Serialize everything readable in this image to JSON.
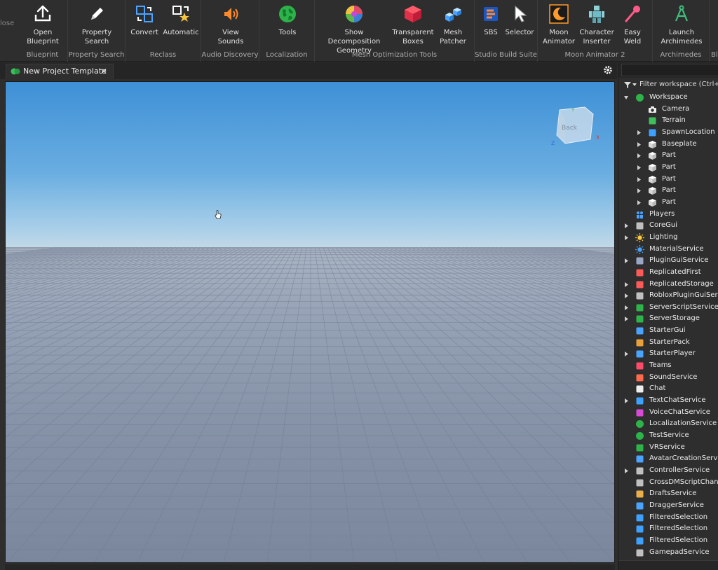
{
  "ribbon": {
    "partial_left_label": "lose",
    "groups": [
      {
        "label": "Blueprint",
        "tools": [
          {
            "label": "Open\nBlueprint",
            "icon": "upload-icon"
          }
        ]
      },
      {
        "label": "Property Search",
        "tools": [
          {
            "label": "Property\nSearch",
            "icon": "pencil-icon"
          }
        ]
      },
      {
        "label": "Reclass",
        "tools": [
          {
            "label": "Convert",
            "icon": "convert-icon"
          },
          {
            "label": "Automatic",
            "icon": "automatic-icon"
          }
        ]
      },
      {
        "label": "Audio Discovery",
        "tools": [
          {
            "label": "View\nSounds",
            "icon": "speaker-icon"
          }
        ]
      },
      {
        "label": "Localization",
        "tools": [
          {
            "label": "Tools",
            "icon": "globe-icon"
          }
        ]
      },
      {
        "label": "Mesh Optimization Tools",
        "tools": [
          {
            "label": "Show Decomposition\nGeometry",
            "icon": "decomposition-icon"
          },
          {
            "label": "Transparent\nBoxes",
            "icon": "red-cube-icon"
          },
          {
            "label": "Mesh\nPatcher",
            "icon": "blue-blocks-icon"
          }
        ]
      },
      {
        "label": "Studio Build Suite",
        "tools": [
          {
            "label": "SBS",
            "icon": "sbs-icon"
          },
          {
            "label": "Selector",
            "icon": "pointer-icon"
          }
        ]
      },
      {
        "label": "Moon Animator 2",
        "tools": [
          {
            "label": "Moon\nAnimator",
            "icon": "moon-icon"
          },
          {
            "label": "Character\nInserter",
            "icon": "character-icon"
          },
          {
            "label": "Easy\nWeld",
            "icon": "weld-icon"
          }
        ]
      },
      {
        "label": "Archimedes",
        "tools": [
          {
            "label": "Launch\nArchimedes",
            "icon": "compass-icon"
          }
        ]
      }
    ],
    "partial_right_label": "Bl"
  },
  "tabs": {
    "document": "New Project Template",
    "close_symbol": "✕"
  },
  "viewcube": {
    "face_label": "Back",
    "axes": {
      "x": "X",
      "y": "Y",
      "z": "Z"
    }
  },
  "explorer": {
    "filter_placeholder": "Filter workspace (Ctrl+Shift+X)",
    "items": [
      {
        "label": "Workspace",
        "depth": 0,
        "expander": "open",
        "icon": "workspace-icon"
      },
      {
        "label": "Camera",
        "depth": 1,
        "expander": "none",
        "icon": "camera-icon"
      },
      {
        "label": "Terrain",
        "depth": 1,
        "expander": "none",
        "icon": "terrain-icon"
      },
      {
        "label": "SpawnLocation",
        "depth": 1,
        "expander": "closed",
        "icon": "spawn-icon"
      },
      {
        "label": "Baseplate",
        "depth": 1,
        "expander": "closed",
        "icon": "part-icon"
      },
      {
        "label": "Part",
        "depth": 1,
        "expander": "closed",
        "icon": "part-icon"
      },
      {
        "label": "Part",
        "depth": 1,
        "expander": "closed",
        "icon": "part-icon"
      },
      {
        "label": "Part",
        "depth": 1,
        "expander": "closed",
        "icon": "part-icon"
      },
      {
        "label": "Part",
        "depth": 1,
        "expander": "closed",
        "icon": "part-icon"
      },
      {
        "label": "Part",
        "depth": 1,
        "expander": "closed",
        "icon": "part-icon"
      },
      {
        "label": "Players",
        "depth": 0,
        "expander": "none",
        "icon": "players-icon"
      },
      {
        "label": "CoreGui",
        "depth": 0,
        "expander": "closed",
        "icon": "coregui-icon"
      },
      {
        "label": "Lighting",
        "depth": 0,
        "expander": "closed",
        "icon": "lighting-icon"
      },
      {
        "label": "MaterialService",
        "depth": 0,
        "expander": "none",
        "icon": "material-icon"
      },
      {
        "label": "PluginGuiService",
        "depth": 0,
        "expander": "closed",
        "icon": "pluginguiservice-icon"
      },
      {
        "label": "ReplicatedFirst",
        "depth": 0,
        "expander": "none",
        "icon": "replicatedfirst-icon"
      },
      {
        "label": "ReplicatedStorage",
        "depth": 0,
        "expander": "closed",
        "icon": "replicatedstorage-icon"
      },
      {
        "label": "RobloxPluginGuiService",
        "depth": 0,
        "expander": "closed",
        "icon": "robloxpluginguiservice-icon"
      },
      {
        "label": "ServerScriptService",
        "depth": 0,
        "expander": "closed",
        "icon": "serverscriptservice-icon"
      },
      {
        "label": "ServerStorage",
        "depth": 0,
        "expander": "closed",
        "icon": "serverstorage-icon"
      },
      {
        "label": "StarterGui",
        "depth": 0,
        "expander": "none",
        "icon": "startergui-icon"
      },
      {
        "label": "StarterPack",
        "depth": 0,
        "expander": "none",
        "icon": "starterpack-icon"
      },
      {
        "label": "StarterPlayer",
        "depth": 0,
        "expander": "closed",
        "icon": "starterplayer-icon"
      },
      {
        "label": "Teams",
        "depth": 0,
        "expander": "none",
        "icon": "teams-icon"
      },
      {
        "label": "SoundService",
        "depth": 0,
        "expander": "none",
        "icon": "soundservice-icon"
      },
      {
        "label": "Chat",
        "depth": 0,
        "expander": "none",
        "icon": "chat-icon"
      },
      {
        "label": "TextChatService",
        "depth": 0,
        "expander": "closed",
        "icon": "textchatservice-icon"
      },
      {
        "label": "VoiceChatService",
        "depth": 0,
        "expander": "none",
        "icon": "voicechatservice-icon"
      },
      {
        "label": "LocalizationService",
        "depth": 0,
        "expander": "none",
        "icon": "localizationservice-icon"
      },
      {
        "label": "TestService",
        "depth": 0,
        "expander": "none",
        "icon": "testservice-icon"
      },
      {
        "label": "VRService",
        "depth": 0,
        "expander": "none",
        "icon": "vrservice-icon"
      },
      {
        "label": "AvatarCreationService",
        "depth": 0,
        "expander": "none",
        "icon": "avatarcreationservice-icon"
      },
      {
        "label": "ControllerService",
        "depth": 0,
        "expander": "closed",
        "icon": "controllerservice-icon"
      },
      {
        "label": "CrossDMScriptChangeListener",
        "depth": 0,
        "expander": "none",
        "icon": "crossdm-icon"
      },
      {
        "label": "DraftsService",
        "depth": 0,
        "expander": "none",
        "icon": "draftsservice-icon"
      },
      {
        "label": "DraggerService",
        "depth": 0,
        "expander": "none",
        "icon": "draggerservice-icon"
      },
      {
        "label": "FilteredSelection",
        "depth": 0,
        "expander": "none",
        "icon": "filteredselection-icon"
      },
      {
        "label": "FilteredSelection",
        "depth": 0,
        "expander": "none",
        "icon": "filteredselection-icon"
      },
      {
        "label": "FilteredSelection",
        "depth": 0,
        "expander": "none",
        "icon": "filteredselection-icon"
      },
      {
        "label": "GamepadService",
        "depth": 0,
        "expander": "none",
        "icon": "gamepadservice-icon"
      }
    ]
  }
}
